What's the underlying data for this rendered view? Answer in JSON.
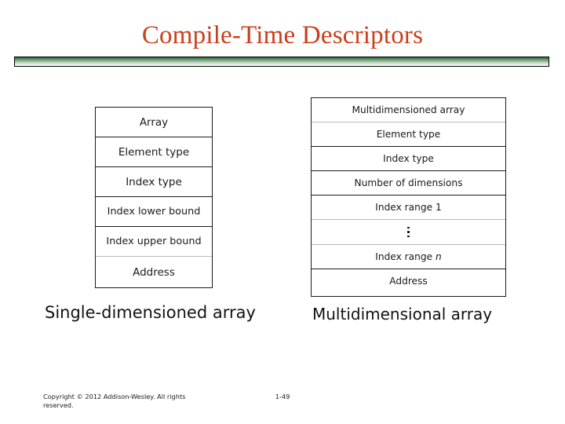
{
  "slide": {
    "title": "Compile-Time Descriptors",
    "title_color": "#cc3d19",
    "divider_color_top": "#2f6b3a",
    "divider_color_bottom": "#ffffff"
  },
  "figures": {
    "single": {
      "caption": "Single-dimensioned array",
      "rows": [
        {
          "label": "Array"
        },
        {
          "label": "Element type"
        },
        {
          "label": "Index type"
        },
        {
          "label": "Index lower bound"
        },
        {
          "label": "Index upper bound"
        },
        {
          "label": "Address"
        }
      ]
    },
    "multi": {
      "caption": "Multidimensional array",
      "rows": [
        {
          "label": "Multidimensioned array"
        },
        {
          "label": "Element type"
        },
        {
          "label": "Index type"
        },
        {
          "label": "Number of dimensions"
        },
        {
          "label": "Index range 1"
        },
        {
          "label": ""
        },
        {
          "label": "Index range n"
        },
        {
          "label": "Address"
        }
      ],
      "index_range_n_prefix": "Index range ",
      "index_range_n_italic": "n"
    }
  },
  "footer": {
    "copyright": "Copyright © 2012 Addison-Wesley. All rights reserved.",
    "slide_number": "1-49"
  }
}
